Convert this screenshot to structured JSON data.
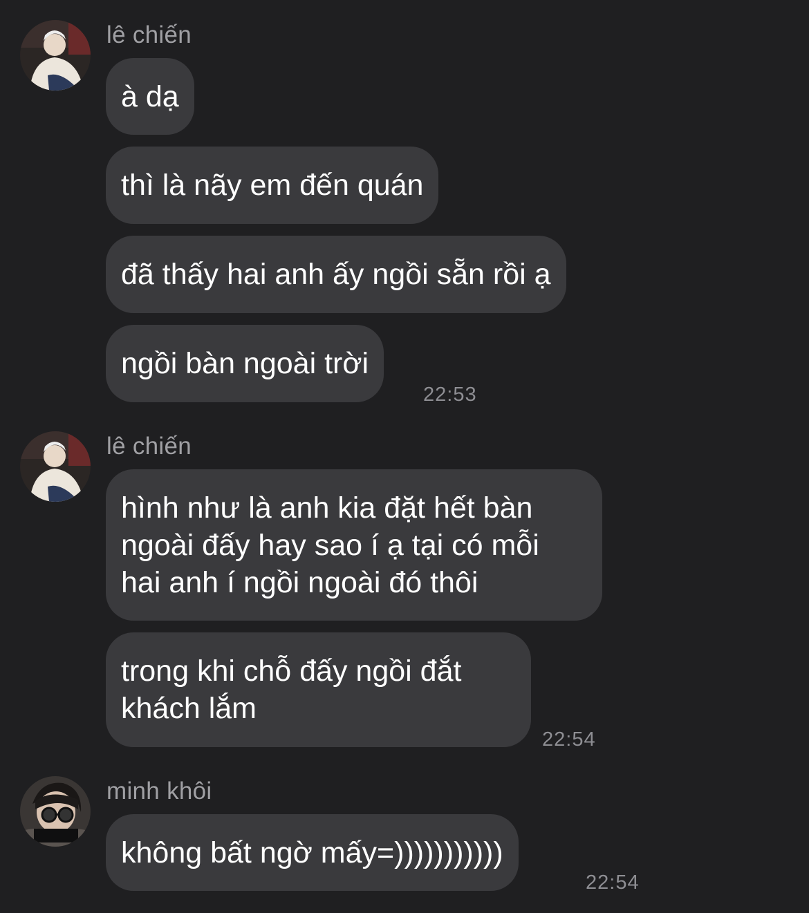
{
  "theme": {
    "background": "#1f1f21",
    "bubble": "#3a3a3d",
    "sender_color": "#a0a0a4",
    "time_color": "#8e8e93",
    "text_color": "#ffffff"
  },
  "groups": [
    {
      "sender": "lê chiến",
      "avatar_icon": "user-avatar-le-chien",
      "messages": [
        "à dạ",
        "thì là nãy em đến quán",
        "đã thấy hai anh ấy ngồi sẵn rồi ạ",
        "ngồi bàn ngoài trời"
      ],
      "time": "22:53"
    },
    {
      "sender": "lê chiến",
      "avatar_icon": "user-avatar-le-chien",
      "messages": [
        "hình như là anh kia đặt hết bàn\nngoài đấy hay sao í ạ tại có mỗi\nhai anh í ngồi ngoài đó thôi",
        "trong khi chỗ đấy ngồi đắt\nkhách lắm"
      ],
      "time": "22:54"
    },
    {
      "sender": "minh khôi",
      "avatar_icon": "user-avatar-minh-khoi",
      "messages": [
        "không bất ngờ mấy=)))))))))))"
      ],
      "time": "22:54"
    }
  ]
}
